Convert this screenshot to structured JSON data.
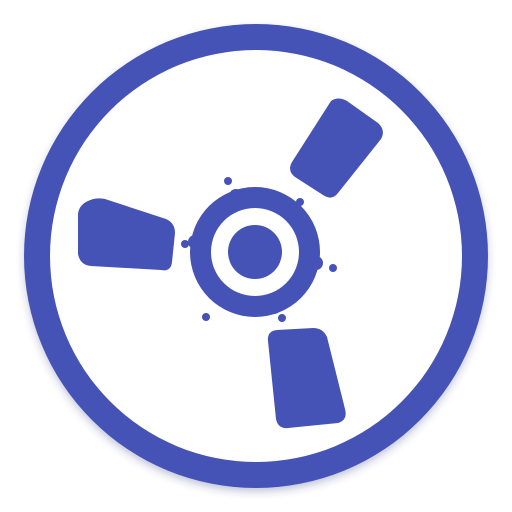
{
  "icon": {
    "name": "reel-icon",
    "colors": {
      "primary": "#4552B6",
      "background": "#FFFFFF",
      "shadow": "#2B347A"
    }
  }
}
